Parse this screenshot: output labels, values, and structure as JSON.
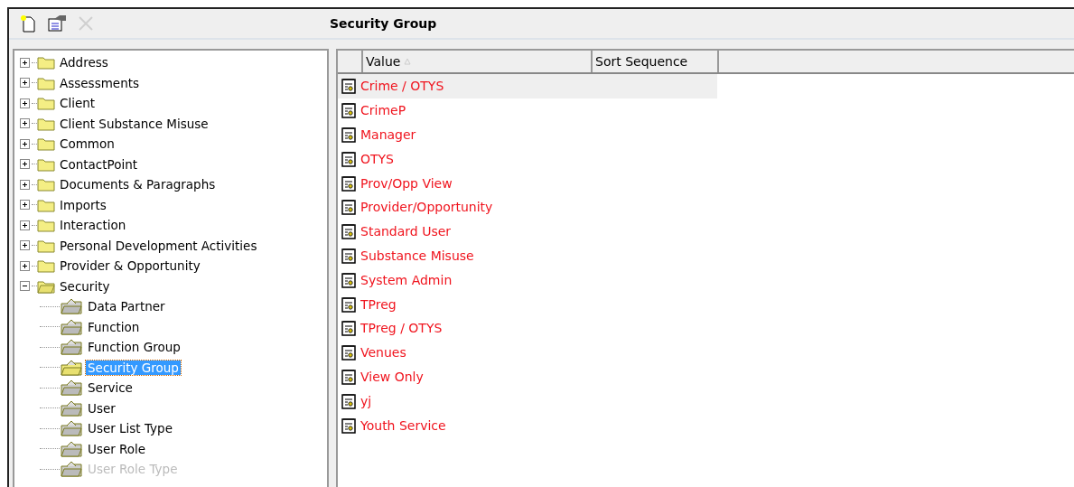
{
  "toolbar": {
    "title": "Security Group",
    "buttons": [
      {
        "kind": "new",
        "disabled": false
      },
      {
        "kind": "properties",
        "disabled": false
      },
      {
        "kind": "delete",
        "disabled": true
      }
    ]
  },
  "tree": [
    {
      "label": "Address",
      "expanded": false,
      "selected": false,
      "dimmed": false
    },
    {
      "label": "Assessments",
      "expanded": false,
      "selected": false,
      "dimmed": false
    },
    {
      "label": "Client",
      "expanded": false,
      "selected": false,
      "dimmed": false
    },
    {
      "label": "Client Substance Misuse",
      "expanded": false,
      "selected": false,
      "dimmed": false
    },
    {
      "label": "Common",
      "expanded": false,
      "selected": false,
      "dimmed": false
    },
    {
      "label": "ContactPoint",
      "expanded": false,
      "selected": false,
      "dimmed": false
    },
    {
      "label": "Documents & Paragraphs",
      "expanded": false,
      "selected": false,
      "dimmed": false
    },
    {
      "label": "Imports",
      "expanded": false,
      "selected": false,
      "dimmed": false
    },
    {
      "label": "Interaction",
      "expanded": false,
      "selected": false,
      "dimmed": false
    },
    {
      "label": "Personal Development Activities",
      "expanded": false,
      "selected": false,
      "dimmed": false
    },
    {
      "label": "Provider & Opportunity",
      "expanded": false,
      "selected": false,
      "dimmed": false
    },
    {
      "label": "Security",
      "expanded": true,
      "selected": false,
      "dimmed": false,
      "children": [
        {
          "label": "Data Partner",
          "selected": false,
          "dimmed": false
        },
        {
          "label": "Function",
          "selected": false,
          "dimmed": false
        },
        {
          "label": "Function Group",
          "selected": false,
          "dimmed": false
        },
        {
          "label": "Security Group",
          "selected": true,
          "dimmed": false
        },
        {
          "label": "Service",
          "selected": false,
          "dimmed": false
        },
        {
          "label": "User",
          "selected": false,
          "dimmed": false
        },
        {
          "label": "User List Type",
          "selected": false,
          "dimmed": false
        },
        {
          "label": "User Role",
          "selected": false,
          "dimmed": false
        },
        {
          "label": "User Role Type",
          "selected": false,
          "dimmed": true
        }
      ]
    }
  ],
  "table": {
    "columns": [
      {
        "label": "Value",
        "sorted": true
      },
      {
        "label": "Sort Sequence",
        "sorted": false
      }
    ],
    "rows": [
      {
        "value": "Crime / OTYS",
        "selected": true
      },
      {
        "value": "CrimeP",
        "selected": false
      },
      {
        "value": "Manager",
        "selected": false
      },
      {
        "value": "OTYS",
        "selected": false
      },
      {
        "value": "Prov/Opp View",
        "selected": false
      },
      {
        "value": "Provider/Opportunity",
        "selected": false
      },
      {
        "value": "Standard User",
        "selected": false
      },
      {
        "value": "Substance Misuse",
        "selected": false
      },
      {
        "value": "System Admin",
        "selected": false
      },
      {
        "value": "TPreg",
        "selected": false
      },
      {
        "value": "TPreg / OTYS",
        "selected": false
      },
      {
        "value": "Venues",
        "selected": false
      },
      {
        "value": "View Only",
        "selected": false
      },
      {
        "value": "yj",
        "selected": false
      },
      {
        "value": "Youth Service",
        "selected": false
      }
    ]
  }
}
